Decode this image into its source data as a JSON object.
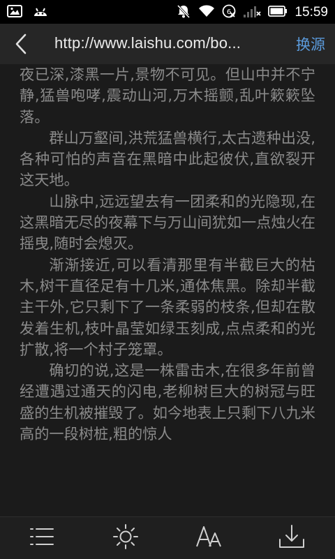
{
  "status_bar": {
    "time": "15:59",
    "icons": [
      "image-icon",
      "android-icon",
      "mute-icon",
      "wifi-icon",
      "data-off-icon",
      "signal-icon",
      "battery-icon"
    ]
  },
  "header": {
    "url": "http://www.laishu.com/bo...",
    "switch_source_label": "换源",
    "back_icon": "chevron-left-icon"
  },
  "content": {
    "paragraphs": [
      "夜已深,漆黑一片,景物不可见。但山中并不宁静,猛兽咆哮,震动山河,万木摇颤,乱叶簌簌坠落。",
      "群山万壑间,洪荒猛兽横行,太古遗种出没,各种可怕的声音在黑暗中此起彼伏,直欲裂开这天地。",
      "山脉中,远远望去有一团柔和的光隐现,在这黑暗无尽的夜幕下与万山间犹如一点烛火在摇曳,随时会熄灭。",
      "渐渐接近,可以看清那里有半截巨大的枯木,树干直径足有十几米,通体焦黑。除却半截主干外,它只剩下了一条柔弱的枝条,但却在散发着生机,枝叶晶莹如绿玉刻成,点点柔和的光扩散,将一个村子笼罩。",
      "确切的说,这是一株雷击木,在很多年前曾经遭遇过通天的闪电,老柳树巨大的树冠与旺盛的生机被摧毁了。如今地表上只剩下八九米高的一段树桩,粗的惊人"
    ]
  },
  "toolbar": {
    "items": [
      "list-icon",
      "brightness-icon",
      "font-size-icon",
      "download-icon"
    ]
  },
  "colors": {
    "background": "#1b1b1b",
    "text": "#8a8a8a",
    "accent": "#5b9bdc"
  }
}
